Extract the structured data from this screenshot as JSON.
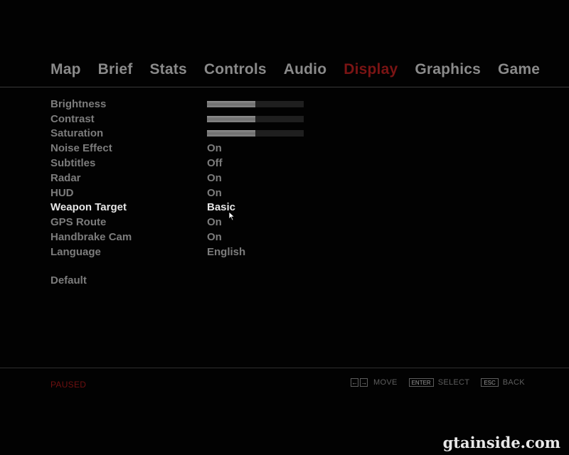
{
  "tabs": [
    {
      "label": "Map",
      "active": false
    },
    {
      "label": "Brief",
      "active": false
    },
    {
      "label": "Stats",
      "active": false
    },
    {
      "label": "Controls",
      "active": false
    },
    {
      "label": "Audio",
      "active": false
    },
    {
      "label": "Display",
      "active": true
    },
    {
      "label": "Graphics",
      "active": false
    },
    {
      "label": "Game",
      "active": false
    }
  ],
  "settings": {
    "brightness": {
      "label": "Brightness",
      "level": 0.5
    },
    "contrast": {
      "label": "Contrast",
      "level": 0.5
    },
    "saturation": {
      "label": "Saturation",
      "level": 0.5
    },
    "noise_effect": {
      "label": "Noise Effect",
      "value": "On"
    },
    "subtitles": {
      "label": "Subtitles",
      "value": "Off"
    },
    "radar": {
      "label": "Radar",
      "value": "On"
    },
    "hud": {
      "label": "HUD",
      "value": "On"
    },
    "weapon_target": {
      "label": "Weapon Target",
      "value": "Basic"
    },
    "gps_route": {
      "label": "GPS Route",
      "value": "On"
    },
    "handbrake_cam": {
      "label": "Handbrake Cam",
      "value": "On"
    },
    "language": {
      "label": "Language",
      "value": "English"
    }
  },
  "default_label": "Default",
  "footer": {
    "status": "PAUSED",
    "move_label": "MOVE",
    "enter_key": "ENTER",
    "select_label": "SELECT",
    "esc_key": "ESC",
    "back_label": "BACK",
    "left_arrow": "←",
    "right_arrow": "→"
  },
  "watermark": "gtainside.com",
  "colors": {
    "accent": "#7a1414",
    "text": "#7c7c7c",
    "selected_text": "#e6e6e6",
    "background": "#020202"
  }
}
